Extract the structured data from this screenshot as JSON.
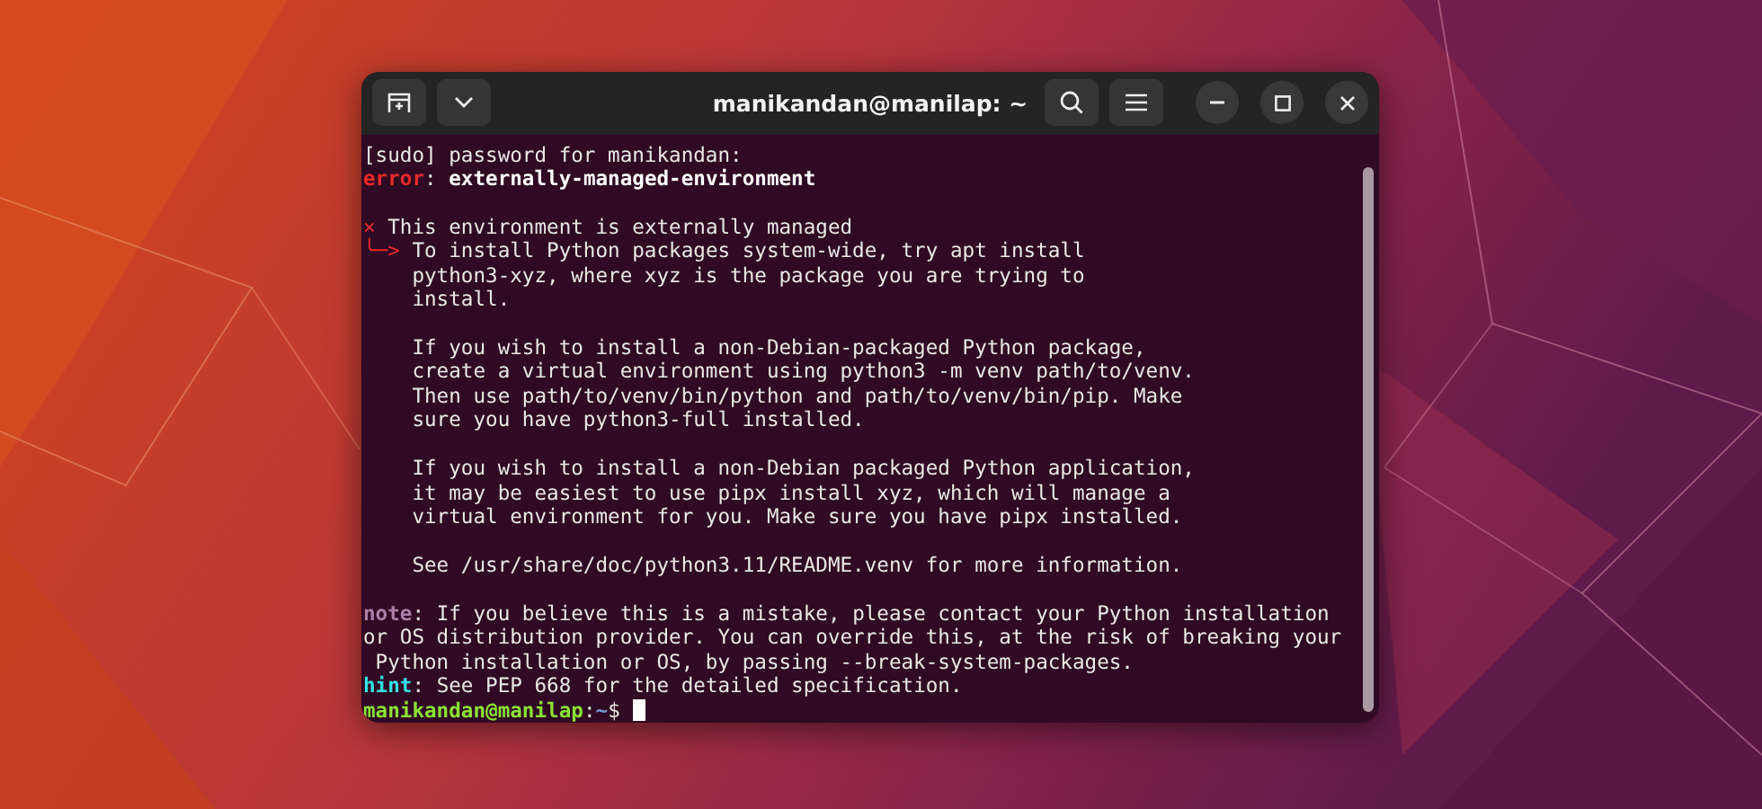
{
  "window": {
    "title": "manikandan@manilap: ~"
  },
  "terminal": {
    "lines": [
      {
        "kind": "text",
        "segments": [
          {
            "kind": "plain",
            "text": "[sudo] password for manikandan:"
          }
        ]
      },
      {
        "kind": "text",
        "segments": [
          {
            "kind": "error",
            "text": "error"
          },
          {
            "kind": "plain",
            "text": ": "
          },
          {
            "kind": "bold",
            "text": "externally-managed-environment"
          }
        ]
      },
      {
        "kind": "blank"
      },
      {
        "kind": "text",
        "segments": [
          {
            "kind": "red",
            "text": "×"
          },
          {
            "kind": "plain",
            "text": " This environment is externally managed"
          }
        ]
      },
      {
        "kind": "text",
        "segments": [
          {
            "kind": "red",
            "text": "╰─>"
          },
          {
            "kind": "plain",
            "text": " To install Python packages system-wide, try apt install"
          }
        ]
      },
      {
        "kind": "text",
        "segments": [
          {
            "kind": "plain",
            "text": "    python3-xyz, where xyz is the package you are trying to"
          }
        ]
      },
      {
        "kind": "text",
        "segments": [
          {
            "kind": "plain",
            "text": "    install."
          }
        ]
      },
      {
        "kind": "blank"
      },
      {
        "kind": "text",
        "segments": [
          {
            "kind": "plain",
            "text": "    If you wish to install a non-Debian-packaged Python package,"
          }
        ]
      },
      {
        "kind": "text",
        "segments": [
          {
            "kind": "plain",
            "text": "    create a virtual environment using python3 -m venv path/to/venv."
          }
        ]
      },
      {
        "kind": "text",
        "segments": [
          {
            "kind": "plain",
            "text": "    Then use path/to/venv/bin/python and path/to/venv/bin/pip. Make"
          }
        ]
      },
      {
        "kind": "text",
        "segments": [
          {
            "kind": "plain",
            "text": "    sure you have python3-full installed."
          }
        ]
      },
      {
        "kind": "blank"
      },
      {
        "kind": "text",
        "segments": [
          {
            "kind": "plain",
            "text": "    If you wish to install a non-Debian packaged Python application,"
          }
        ]
      },
      {
        "kind": "text",
        "segments": [
          {
            "kind": "plain",
            "text": "    it may be easiest to use pipx install xyz, which will manage a"
          }
        ]
      },
      {
        "kind": "text",
        "segments": [
          {
            "kind": "plain",
            "text": "    virtual environment for you. Make sure you have pipx installed."
          }
        ]
      },
      {
        "kind": "blank"
      },
      {
        "kind": "text",
        "segments": [
          {
            "kind": "plain",
            "text": "    See /usr/share/doc/python3.11/README.venv for more information."
          }
        ]
      },
      {
        "kind": "blank"
      },
      {
        "kind": "text",
        "segments": [
          {
            "kind": "note",
            "text": "note"
          },
          {
            "kind": "plain",
            "text": ": If you believe this is a mistake, please contact your Python installation"
          }
        ]
      },
      {
        "kind": "text",
        "segments": [
          {
            "kind": "plain",
            "text": "or OS distribution provider. You can override this, at the risk of breaking your"
          }
        ]
      },
      {
        "kind": "text",
        "segments": [
          {
            "kind": "plain",
            "text": " Python installation or OS, by passing --break-system-packages."
          }
        ]
      },
      {
        "kind": "text",
        "segments": [
          {
            "kind": "hint",
            "text": "hint"
          },
          {
            "kind": "plain",
            "text": ": See PEP 668 for the detailed specification."
          }
        ]
      }
    ],
    "prompt": {
      "user": "manikandan@manilap",
      "separator": ":",
      "path": "~",
      "symbol": "$ "
    }
  }
}
